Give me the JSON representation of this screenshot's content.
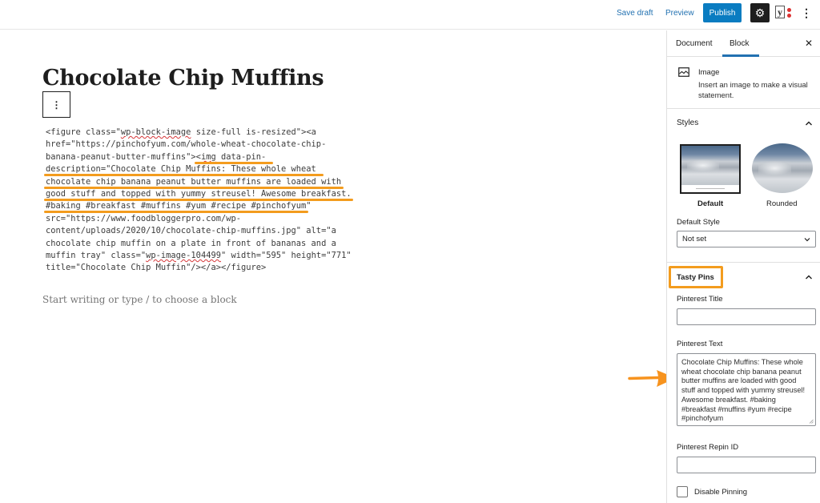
{
  "topbar": {
    "save_draft": "Save draft",
    "preview": "Preview",
    "publish": "Publish",
    "settings_icon": "gear-icon",
    "plugin_icon": "yoast-seo-icon",
    "more_icon": "vertical-ellipsis-icon",
    "more_glyph": "⋮",
    "settings_glyph": "⚙",
    "yoast_glyph": "y"
  },
  "editor": {
    "post_title": "Chocolate Chip Muffins",
    "block_toolbar_glyph": "⋮",
    "code_lines": [
      "<figure class=\"wp-block-image size-full is-resized\"><a",
      "href=\"https://pinchofyum.com/whole-wheat-chocolate-chip-",
      "banana-peanut-butter-muffins\"><img data-pin-",
      "description=\"Chocolate Chip Muffins: These whole wheat",
      "chocolate chip banana peanut butter muffins are loaded with",
      "good stuff and topped with yummy streusel! Awesome breakfast.",
      "#baking #breakfast #muffins #yum #recipe #pinchofyum\"",
      "src=\"https://www.foodbloggerpro.com/wp-",
      "content/uploads/2020/10/chocolate-chip-muffins.jpg\" alt=\"a",
      "chocolate chip muffin on a plate in front of bananas and a",
      "muffin tray\" class=\"wp-image-104499\" width=\"595\" height=\"771\"",
      "title=\"Chocolate Chip Muffin\"/></a></figure>"
    ],
    "block_placeholder": "Start writing or type / to choose a block"
  },
  "annotation": {
    "highlight_color": "#f39c1e",
    "arrow_color": "#f7931e"
  },
  "sidebar": {
    "tabs": [
      {
        "label": "Document",
        "active": false
      },
      {
        "label": "Block",
        "active": true
      }
    ],
    "close_glyph": "✕",
    "block_card": {
      "icon": "image-icon",
      "name": "Image",
      "description": "Insert an image to make a visual statement."
    },
    "styles": {
      "title": "Styles",
      "options": [
        {
          "label": "Default",
          "selected": true
        },
        {
          "label": "Rounded",
          "selected": false
        }
      ],
      "default_style_label": "Default Style",
      "default_style_value": "Not set"
    },
    "tasty_pins": {
      "title": "Tasty Pins",
      "pinterest_title_label": "Pinterest Title",
      "pinterest_title_value": "",
      "pinterest_text_label": "Pinterest Text",
      "pinterest_text_value": "Chocolate Chip Muffins: These whole wheat chocolate chip banana peanut butter muffins are loaded with good stuff and topped with yummy streusel! Awesome breakfast. #baking #breakfast #muffins #yum #recipe #pinchofyum",
      "repin_id_label": "Pinterest Repin ID",
      "repin_id_value": "",
      "disable_pinning_label": "Disable Pinning",
      "disable_pinning_checked": false
    },
    "accent_color": "#2271b1",
    "publish_color": "#0a7cc1"
  }
}
